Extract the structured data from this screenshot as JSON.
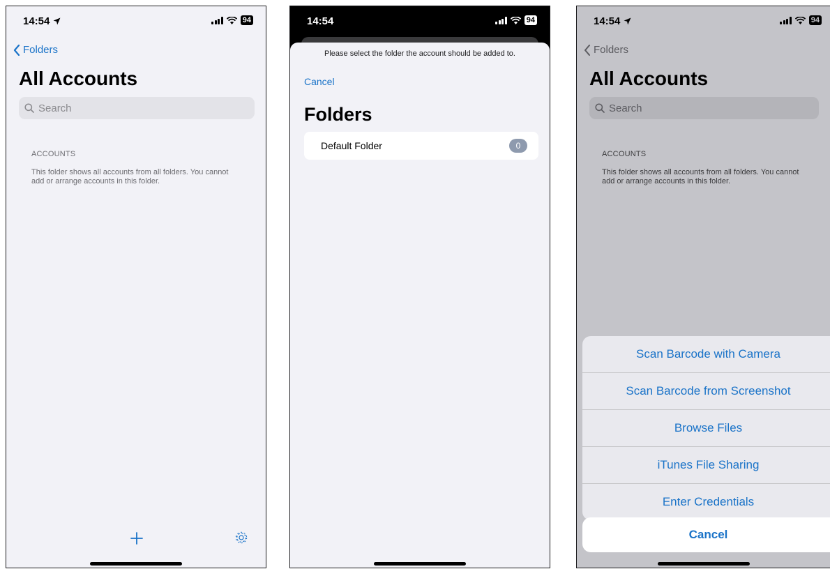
{
  "colors": {
    "accent": "#1a73c8",
    "badge": "#8e9aae",
    "background": "#f2f2f7"
  },
  "icons": [
    "location-arrow-icon",
    "signal-icon",
    "wifi-icon",
    "battery-icon",
    "chevron-left-icon",
    "search-icon",
    "plus-icon",
    "gear-icon"
  ],
  "screen1": {
    "status": {
      "time": "14:54",
      "battery": "94"
    },
    "back_label": "Folders",
    "title": "All Accounts",
    "search_placeholder": "Search",
    "section_header": "ACCOUNTS",
    "section_footer": "This folder shows all accounts from all folders. You cannot add or arrange accounts in this folder."
  },
  "screen2": {
    "status": {
      "time": "14:54",
      "battery": "94"
    },
    "prompt": "Please select the folder the account should be added to.",
    "cancel_label": "Cancel",
    "title": "Folders",
    "folders": [
      {
        "name": "Default Folder",
        "count": "0"
      }
    ]
  },
  "screen3": {
    "status": {
      "time": "14:54",
      "battery": "94"
    },
    "back_label": "Folders",
    "title": "All Accounts",
    "search_placeholder": "Search",
    "section_header": "ACCOUNTS",
    "section_footer": "This folder shows all accounts from all folders. You cannot add or arrange accounts in this folder.",
    "actions": [
      "Scan Barcode with Camera",
      "Scan Barcode from Screenshot",
      "Browse Files",
      "iTunes File Sharing",
      "Enter Credentials"
    ],
    "cancel_label": "Cancel"
  }
}
